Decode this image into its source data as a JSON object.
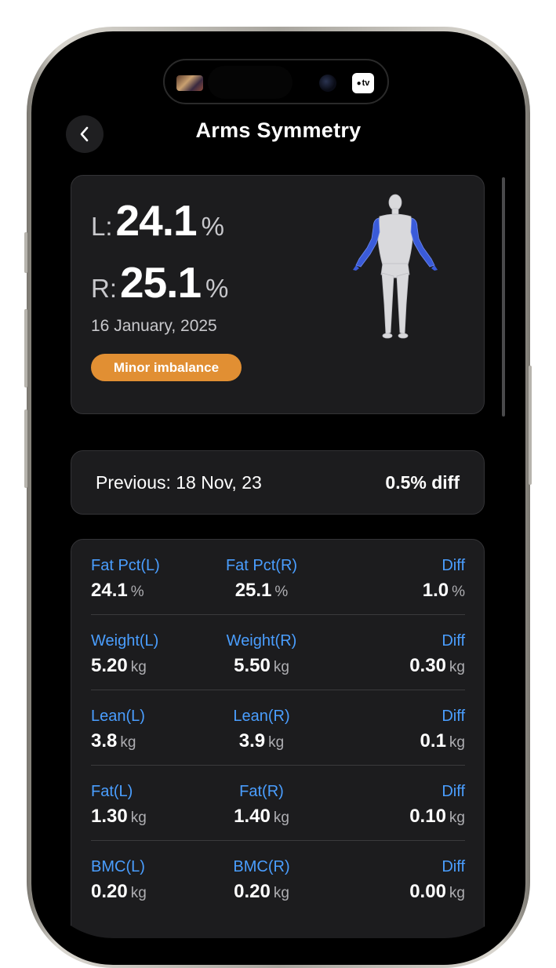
{
  "header": {
    "title": "Arms Symmetry",
    "back_icon": "chevron-left-icon"
  },
  "island": {
    "tv_label": "tv"
  },
  "summary": {
    "left_prefix": "L:",
    "left_value": "24.1",
    "right_prefix": "R:",
    "right_value": "25.1",
    "unit": "%",
    "date": "16 January, 2025",
    "badge": "Minor imbalance",
    "badge_color": "#e18f33",
    "highlight_color": "#3a5bd9"
  },
  "previous": {
    "label": "Previous: 18 Nov, 23",
    "diff": "0.5% diff"
  },
  "metrics": [
    {
      "l_label": "Fat Pct(L)",
      "l_value": "24.1",
      "r_label": "Fat Pct(R)",
      "r_value": "25.1",
      "d_label": "Diff",
      "d_value": "1.0",
      "unit": "%"
    },
    {
      "l_label": "Weight(L)",
      "l_value": "5.20",
      "r_label": "Weight(R)",
      "r_value": "5.50",
      "d_label": "Diff",
      "d_value": "0.30",
      "unit": "kg"
    },
    {
      "l_label": "Lean(L)",
      "l_value": "3.8",
      "r_label": "Lean(R)",
      "r_value": "3.9",
      "d_label": "Diff",
      "d_value": "0.1",
      "unit": "kg"
    },
    {
      "l_label": "Fat(L)",
      "l_value": "1.30",
      "r_label": "Fat(R)",
      "r_value": "1.40",
      "d_label": "Diff",
      "d_value": "0.10",
      "unit": "kg"
    },
    {
      "l_label": "BMC(L)",
      "l_value": "0.20",
      "r_label": "BMC(R)",
      "r_value": "0.20",
      "d_label": "Diff",
      "d_value": "0.00",
      "unit": "kg"
    }
  ],
  "colors": {
    "label_blue": "#4a9eff",
    "card_bg": "#1c1c1e"
  }
}
